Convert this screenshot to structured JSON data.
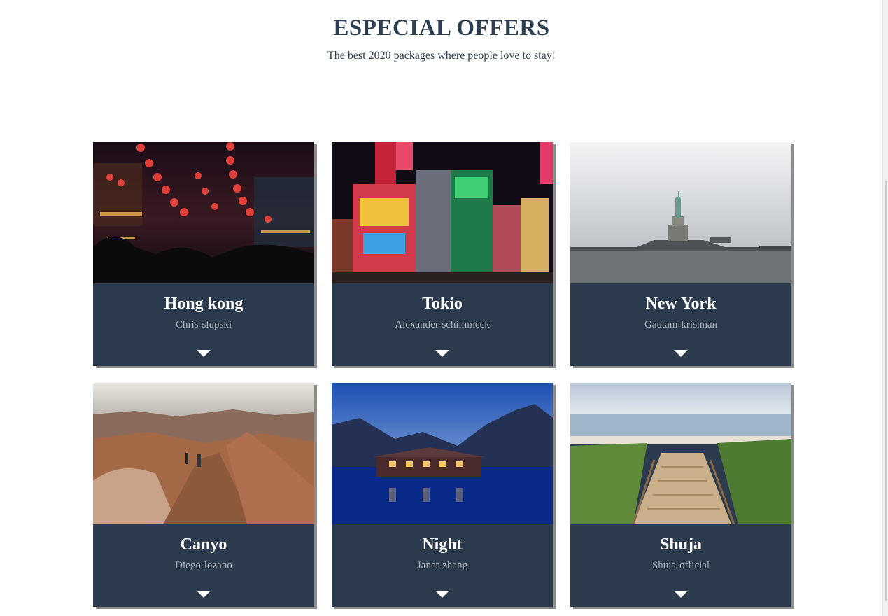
{
  "header": {
    "title": "ESPECIAL OFFERS",
    "subtitle": "The best 2020 packages where people love to stay!"
  },
  "cards": [
    {
      "title": "Hong kong",
      "credit": "Chris-slupski",
      "image": "night-market-lanterns",
      "expand_icon": "caret-down-icon"
    },
    {
      "title": "Tokio",
      "credit": "Alexander-schimmeck",
      "image": "neon-city-street",
      "expand_icon": "caret-down-icon"
    },
    {
      "title": "New York",
      "credit": "Gautam-krishnan",
      "image": "statue-of-liberty",
      "expand_icon": "caret-down-icon"
    },
    {
      "title": "Canyo",
      "credit": "Diego-lozano",
      "image": "canyon-trail",
      "expand_icon": "caret-down-icon"
    },
    {
      "title": "Night",
      "credit": "Janer-zhang",
      "image": "lake-house-dusk",
      "expand_icon": "caret-down-icon"
    },
    {
      "title": "Shuja",
      "credit": "Shuja-official",
      "image": "beach-boardwalk",
      "expand_icon": "caret-down-icon"
    }
  ],
  "colors": {
    "heading": "#2c3e50",
    "card_bg": "#2c3a4e",
    "card_credit": "#a7b0bd",
    "card_shadow": "#8c8c8c"
  }
}
